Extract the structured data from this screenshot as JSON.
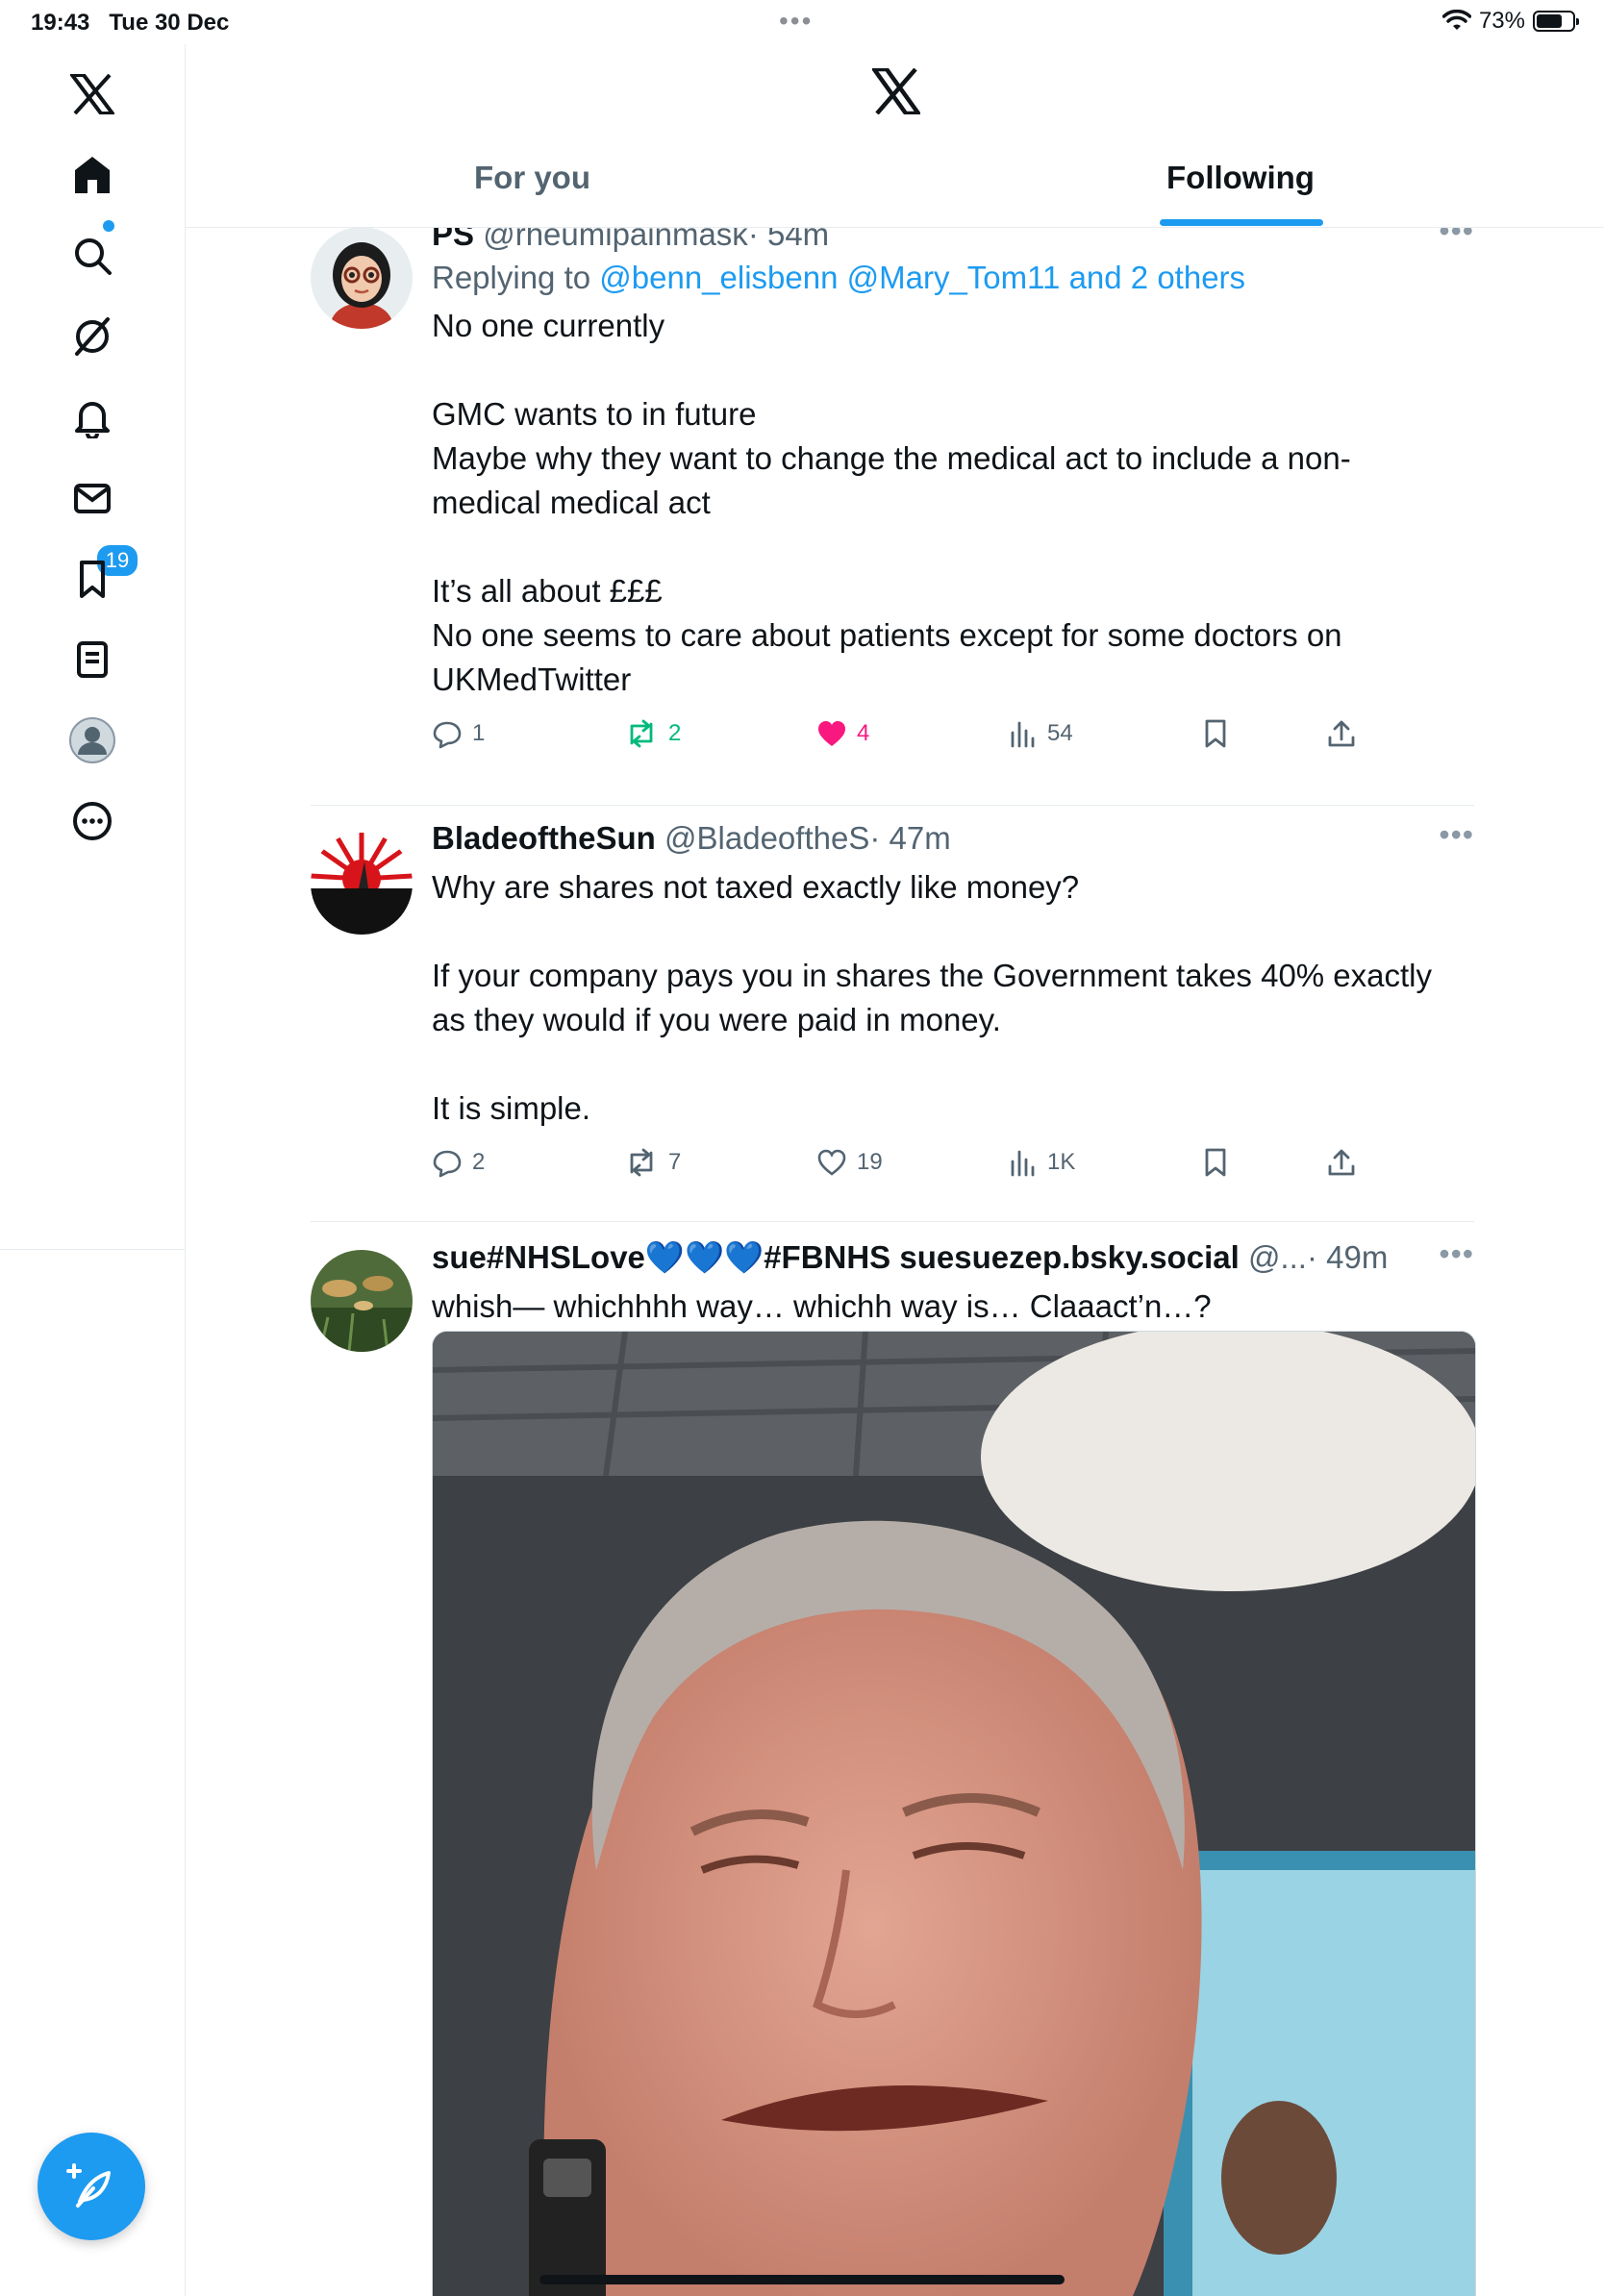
{
  "status_bar": {
    "time": "19:43",
    "date": "Tue 30 Dec",
    "battery": "73%",
    "battery_level": 0.73
  },
  "nav": {
    "notification_count": "19"
  },
  "tabs": [
    {
      "label": "For you",
      "active": false
    },
    {
      "label": "Following",
      "active": true
    }
  ],
  "tweets": [
    {
      "name": "PS",
      "handle": "@rheumipainmask",
      "time": "· 54m",
      "replying_prefix": "Replying to ",
      "replying_links": "@benn_elisbenn @Mary_Tom11 and 2 others",
      "text": "No one currently\n\nGMC wants to in future\nMaybe why they want to change the medical act to include a non-\nmedical medical act\n\nIt’s all about £££\nNo one seems to care about patients except for some doctors on\nUKMedTwitter",
      "replies": "1",
      "reposts": "2",
      "likes": "4",
      "views": "54"
    },
    {
      "name": "BladeoftheSun",
      "handle": "@BladeoftheS",
      "time": "· 47m",
      "text": "Why are shares not taxed exactly like money?\n\nIf your company pays you in shares the Government takes 40% exactly\nas they would if you were paid in money.\n\nIt is simple.",
      "replies": "2",
      "reposts": "7",
      "likes": "19",
      "views": "1K"
    },
    {
      "name": "sue#NHSLove💙💙💙#FBNHS suesuezep.bsky.social",
      "handle": "@...",
      "time": "· 49m",
      "text": "whish— whichhhh way… whichh way is… Claaact’n…?"
    }
  ],
  "colors": {
    "accent": "#1d9bf0",
    "like": "#f91880",
    "repost": "#00ba7c",
    "muted": "#536471"
  }
}
